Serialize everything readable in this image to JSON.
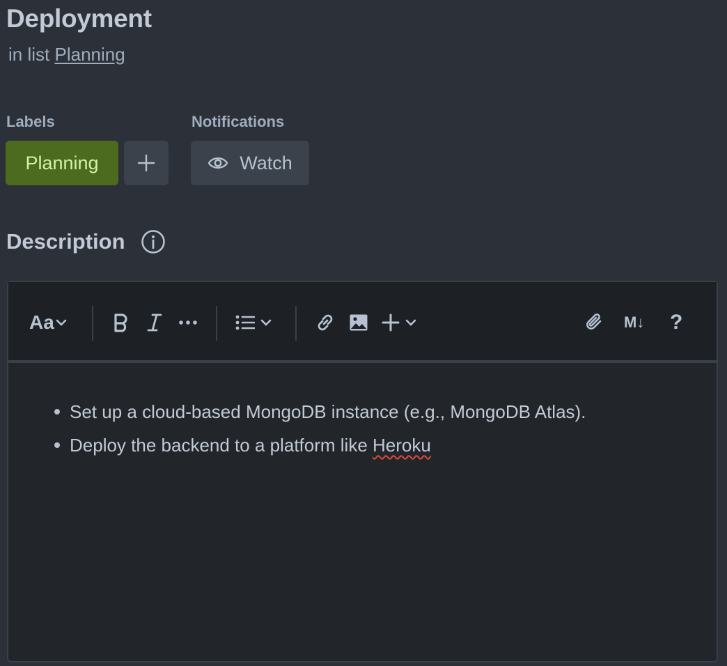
{
  "card": {
    "title": "Deployment",
    "in_list_prefix": "in list",
    "list_name": "Planning"
  },
  "labels": {
    "heading": "Labels",
    "items": [
      {
        "text": "Planning",
        "color": "#4c6b1f",
        "text_color": "#d3f1a7"
      }
    ],
    "add_icon": "plus-icon"
  },
  "notifications": {
    "heading": "Notifications",
    "watch_label": "Watch",
    "watch_icon": "eye-icon"
  },
  "description": {
    "heading": "Description",
    "info_icon": "info-circle-icon",
    "toolbar": {
      "text_style": "Aa",
      "icons": [
        "chevron-down-icon",
        "bold-icon",
        "italic-icon",
        "more-formatting-icon",
        "bullet-list-icon",
        "link-icon",
        "image-icon",
        "insert-plus-icon",
        "attachment-icon",
        "markdown-icon",
        "help-icon"
      ],
      "markdown_label": "M↓",
      "help_label": "?"
    },
    "bullets": [
      {
        "text": "Set up a cloud-based MongoDB instance (e.g., MongoDB Atlas)."
      },
      {
        "text_before": "Deploy the backend to a platform like ",
        "text_misspelled": "Heroku"
      }
    ]
  },
  "colors": {
    "background": "#2c3038",
    "editor_background": "#22252a",
    "toolbar_background": "#1d2025",
    "button_background": "#3b424b",
    "spellcheck_underline": "#e0483e"
  }
}
